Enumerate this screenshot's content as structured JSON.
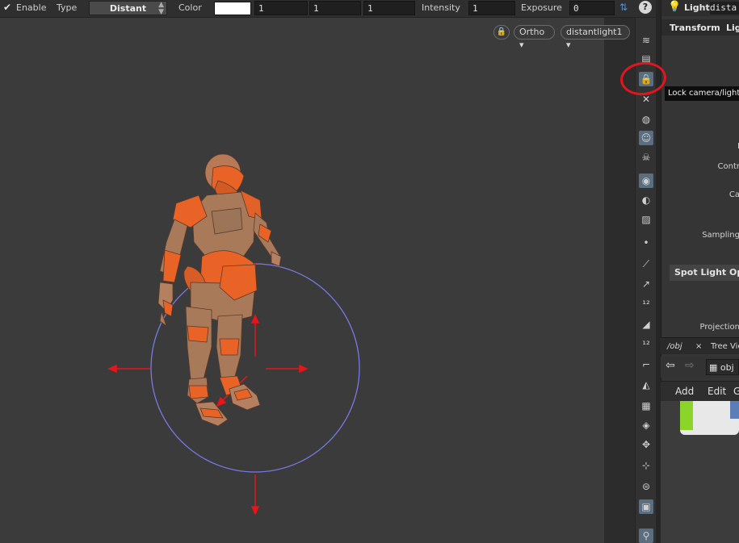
{
  "toolbar": {
    "enable_label": "Enable",
    "type_label": "Type",
    "type_value": "Distant",
    "color_label": "Color",
    "color_swatch": "#ffffff",
    "color_r": "1",
    "color_g": "1",
    "color_b": "1",
    "intensity_label": "Intensity",
    "intensity_value": "1",
    "exposure_label": "Exposure",
    "exposure_value": "0"
  },
  "viewport": {
    "projection": "Ortho ▾",
    "camera": "distantlight1 ▾"
  },
  "tooltip": "Lock camera/light",
  "panel": {
    "node_type": "Light",
    "node_name": "dista",
    "tabs": [
      "Transform",
      "Ligh"
    ],
    "param_labels": [
      "I",
      "Contr",
      "Ca",
      "Sampling"
    ],
    "spot_section": "Spot Light Option",
    "projection_label": "Projection"
  },
  "network": {
    "tab_obj": "/obj",
    "tab_tree": "Tree View",
    "path": "obj",
    "menu": [
      "Add",
      "Edit",
      "G"
    ]
  },
  "colors": {
    "accent_active": "#5b6e80",
    "annotation_red": "#e0161e",
    "handle_red": "#e8151b",
    "light_circle": "#7a78e6",
    "figure_orange": "#e8632a"
  }
}
